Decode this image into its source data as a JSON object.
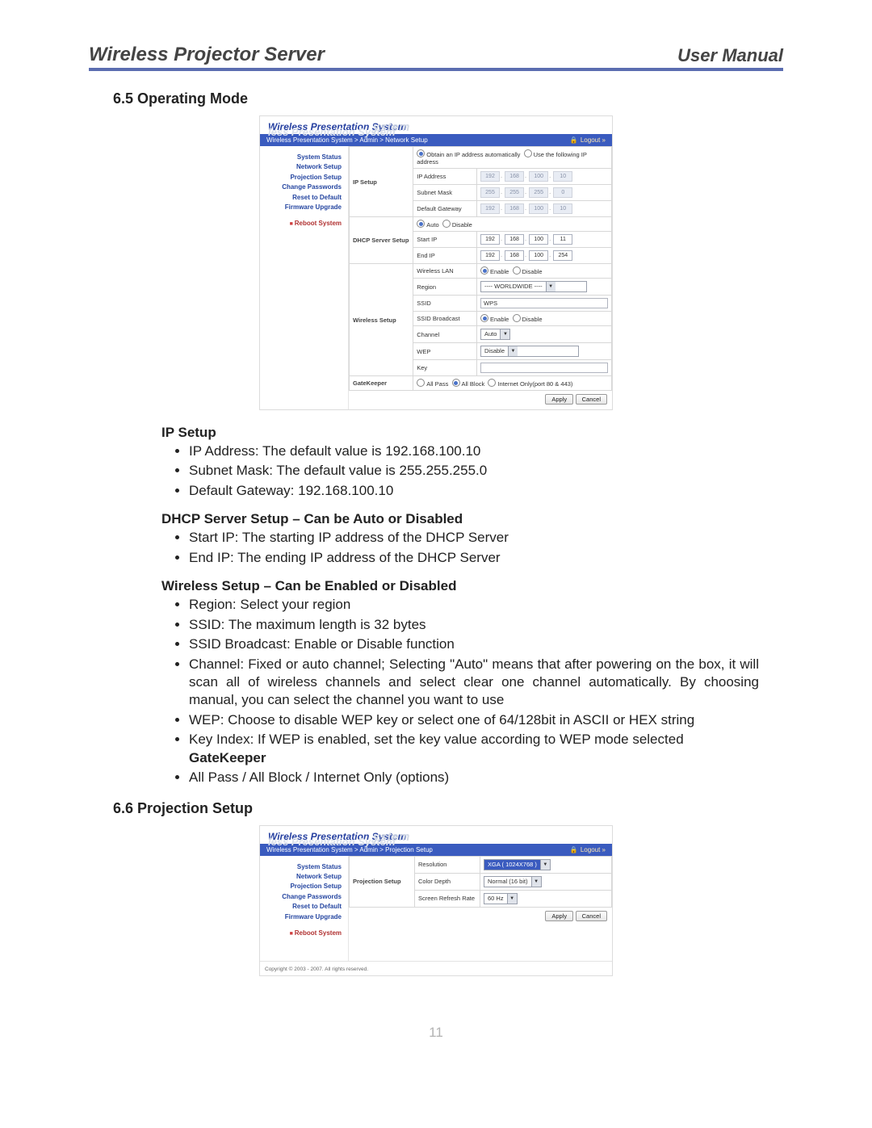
{
  "doc": {
    "header_left": "Wireless Projector Server",
    "header_right": "User Manual",
    "page_number": "11",
    "s65_title": "6.5   Operating Mode",
    "s66_title": "6.6   Projection Setup",
    "h_ip": "IP Setup",
    "h_dhcp": "DHCP Server Setup – Can be Auto or Disabled",
    "h_wireless": "Wireless Setup – Can be Enabled or Disabled",
    "h_gatekeeper": "GateKeeper",
    "li_ip1": "IP Address: The default value is 192.168.100.10",
    "li_ip2": "Subnet Mask: The default value is 255.255.255.0",
    "li_ip3": "Default Gateway: 192.168.100.10",
    "li_dh1": "Start IP: The starting IP address of the DHCP Server",
    "li_dh2": "End IP: The ending IP address of the DHCP Server",
    "li_w1": "Region: Select your region",
    "li_w2": "SSID: The maximum length is 32 bytes",
    "li_w3": "SSID Broadcast: Enable or Disable function",
    "li_w4": "Channel: Fixed or auto channel; Selecting \"Auto\" means that after powering on the box, it will scan all of wireless channels and select clear one channel automatically. By choosing manual, you can select the channel you want to use",
    "li_w5": "WEP: Choose to disable WEP key or select one of 64/128bit in ASCII or HEX string",
    "li_w6": "Key Index: If WEP is enabled, set the key value according to WEP mode selected",
    "li_gk1": "All Pass / All Block / Internet Only (options)"
  },
  "common": {
    "brand_main": "Wireless Presentation System",
    "brand_ghost": "ystem",
    "brand_ghost2": "less Presentation System",
    "logout": "Logout »",
    "apply": "Apply",
    "cancel": "Cancel",
    "copyright": "Copyright © 2003 - 2007. All rights reserved.",
    "nav": {
      "system_status": "System Status",
      "network_setup": "Network Setup",
      "projection_setup": "Projection Setup",
      "change_passwords": "Change Passwords",
      "reset_default": "Reset to Default",
      "firmware_upgrade": "Firmware Upgrade",
      "reboot": "Reboot System"
    }
  },
  "net": {
    "crumb": "Wireless Presentation System > Admin > Network Setup",
    "grp_ip": "IP Setup",
    "grp_dhcp": "DHCP Server Setup",
    "grp_wireless": "Wireless Setup",
    "grp_gate": "GateKeeper",
    "r_auto_ip": "Obtain an IP address automatically",
    "r_use_following": "Use the following IP address",
    "lab_ipaddr": "IP Address",
    "lab_subnet": "Subnet Mask",
    "lab_gateway": "Default Gateway",
    "ip": [
      "192",
      "168",
      "100",
      "10"
    ],
    "subnet": [
      "255",
      "255",
      "255",
      "0"
    ],
    "gateway": [
      "192",
      "168",
      "100",
      "10"
    ],
    "dhcp_auto": "Auto",
    "dhcp_disable": "Disable",
    "lab_start": "Start IP",
    "lab_end": "End IP",
    "start_ip": [
      "192",
      "168",
      "100",
      "11"
    ],
    "end_ip": [
      "192",
      "168",
      "100",
      "254"
    ],
    "lab_wlan": "Wireless LAN",
    "wlan_enable": "Enable",
    "wlan_disable": "Disable",
    "lab_region": "Region",
    "region_val": "---- WORLDWIDE ----",
    "lab_ssid": "SSID",
    "ssid_val": "WPS",
    "lab_ssidbc": "SSID Broadcast",
    "ssidbc_enable": "Enable",
    "ssidbc_disable": "Disable",
    "lab_channel": "Channel",
    "channel_val": "Auto",
    "lab_wep": "WEP",
    "wep_val": "Disable",
    "lab_key": "Key",
    "key_val": "",
    "gk_allpass": "All Pass",
    "gk_allblock": "All Block",
    "gk_internet": "Internet Only(port 80 & 443)"
  },
  "proj": {
    "crumb": "Wireless Presentation System > Admin > Projection Setup",
    "grp": "Projection Setup",
    "lab_res": "Resolution",
    "res_val": "XGA ( 1024X768 )",
    "lab_depth": "Color Depth",
    "depth_val": "Normal (16 bit)",
    "lab_refresh": "Screen Refresh Rate",
    "refresh_val": "60 Hz"
  }
}
